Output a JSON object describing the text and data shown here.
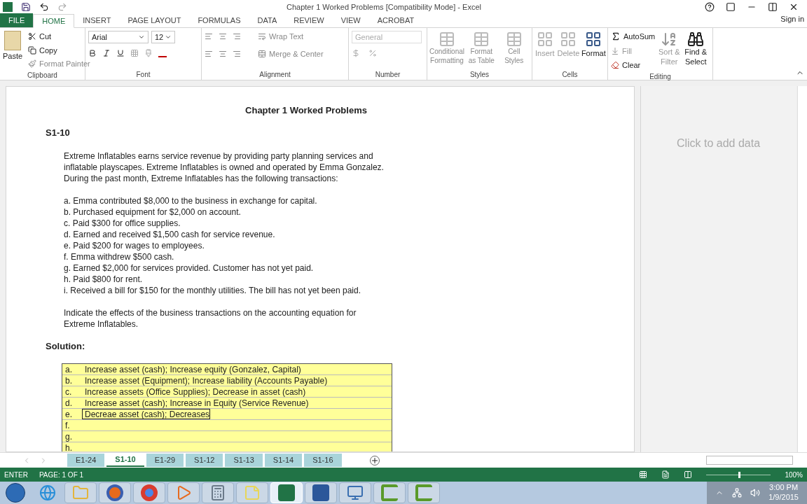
{
  "window": {
    "title": "Chapter 1 Worked Problems  [Compatibility Mode] - Excel",
    "sign_in": "Sign in"
  },
  "ribbon_tabs": [
    {
      "label": "FILE",
      "kind": "file",
      "selected": false
    },
    {
      "label": "HOME",
      "kind": "tab",
      "selected": true
    },
    {
      "label": "INSERT",
      "kind": "tab",
      "selected": false
    },
    {
      "label": "PAGE LAYOUT",
      "kind": "tab",
      "selected": false
    },
    {
      "label": "FORMULAS",
      "kind": "tab",
      "selected": false
    },
    {
      "label": "DATA",
      "kind": "tab",
      "selected": false
    },
    {
      "label": "REVIEW",
      "kind": "tab",
      "selected": false
    },
    {
      "label": "VIEW",
      "kind": "tab",
      "selected": false
    },
    {
      "label": "ACROBAT",
      "kind": "tab",
      "selected": false
    }
  ],
  "ribbon": {
    "clipboard": {
      "label": "Clipboard",
      "paste": "Paste",
      "cut": "Cut",
      "copy": "Copy",
      "format_painter": "Format Painter"
    },
    "font": {
      "label": "Font",
      "name": "Arial",
      "size": "12"
    },
    "alignment": {
      "label": "Alignment",
      "wrap_text": "Wrap Text",
      "merge": "Merge & Center"
    },
    "number": {
      "label": "Number",
      "format": "General"
    },
    "styles": {
      "label": "Styles",
      "items": [
        "Conditional Formatting",
        "Format as Table",
        "Cell Styles"
      ]
    },
    "cells": {
      "label": "Cells",
      "items": [
        {
          "label": "Insert",
          "disabled": true
        },
        {
          "label": "Delete",
          "disabled": true
        },
        {
          "label": "Format",
          "disabled": false
        }
      ]
    },
    "editing": {
      "label": "Editing",
      "autosum": "AutoSum",
      "fill": "Fill",
      "clear": "Clear",
      "sort": "Sort & Filter",
      "find": "Find & Select"
    }
  },
  "sheet": {
    "title": "Chapter 1 Worked Problems",
    "problem": "S1-10",
    "intro_lines": [
      "Extreme Inflatables earns service revenue by providing party planning services and",
      "inflatable playscapes. Extreme Inflatables is owned and operated by Emma Gonzalez.",
      "During the past month, Extreme Inflatables has the following transactions:"
    ],
    "transactions": [
      "a. Emma contributed $8,000 to the business in exchange for capital.",
      "b. Purchased equipment for $2,000 on account.",
      "c. Paid $300 for office supplies.",
      "d. Earned and received $1,500 cash for service revenue.",
      "e. Paid $200 for wages to employees.",
      "f. Emma withdrew $500 cash.",
      "g. Earned $2,000 for services provided. Customer has not yet paid.",
      "h. Paid $800 for rent.",
      "i. Received a bill for $150 for the monthly utilities. The bill has not yet been paid."
    ],
    "question_lines": [
      "Indicate the effects of the business transactions on the accounting equation for",
      "Extreme Inflatables."
    ],
    "solution_label": "Solution:",
    "solution_rows": [
      {
        "letter": "a.",
        "text": "Increase asset (cash); Increase equity (Gonzalez, Capital)",
        "selected": false
      },
      {
        "letter": "b.",
        "text": "Increase asset (Equipment); Increase liability (Accounts Payable)",
        "selected": false
      },
      {
        "letter": "c.",
        "text": "Increase assets (Office Supplies); Decrease in asset (cash)",
        "selected": false
      },
      {
        "letter": "d.",
        "text": "Increase asset (cash); Increase in Equity (Service Revenue)",
        "selected": false
      },
      {
        "letter": "e.",
        "text": "Decreae asset (cash); Decreases",
        "selected": true
      },
      {
        "letter": "f.",
        "text": "",
        "selected": false
      },
      {
        "letter": "g.",
        "text": "",
        "selected": false
      },
      {
        "letter": "h.",
        "text": "",
        "selected": false
      }
    ],
    "side_pane": "Click to add data"
  },
  "sheet_tabs": [
    {
      "label": "E1-24",
      "selected": false
    },
    {
      "label": "S1-10",
      "selected": true
    },
    {
      "label": "E1-29",
      "selected": false
    },
    {
      "label": "S1-12",
      "selected": false
    },
    {
      "label": "S1-13",
      "selected": false
    },
    {
      "label": "S1-14",
      "selected": false
    },
    {
      "label": "S1-16",
      "selected": false
    }
  ],
  "status_bar": {
    "mode": "ENTER",
    "page": "PAGE: 1 OF 1",
    "zoom": "100%",
    "zoom_slider": {
      "level": 0.5
    }
  },
  "taskbar": {
    "time": "3:00 PM",
    "date": "1/9/2015",
    "apps": [
      {
        "kind": "folder",
        "selected": false
      },
      {
        "kind": "firefox",
        "selected": false
      },
      {
        "kind": "chrome",
        "selected": false
      },
      {
        "kind": "media",
        "selected": false
      },
      {
        "kind": "calculator",
        "selected": false
      },
      {
        "kind": "notes",
        "selected": false
      },
      {
        "kind": "excel",
        "selected": true
      },
      {
        "kind": "word",
        "selected": false
      },
      {
        "kind": "remote",
        "selected": false
      },
      {
        "kind": "camtasia",
        "selected": false
      },
      {
        "kind": "camtasia",
        "selected": false
      }
    ]
  }
}
